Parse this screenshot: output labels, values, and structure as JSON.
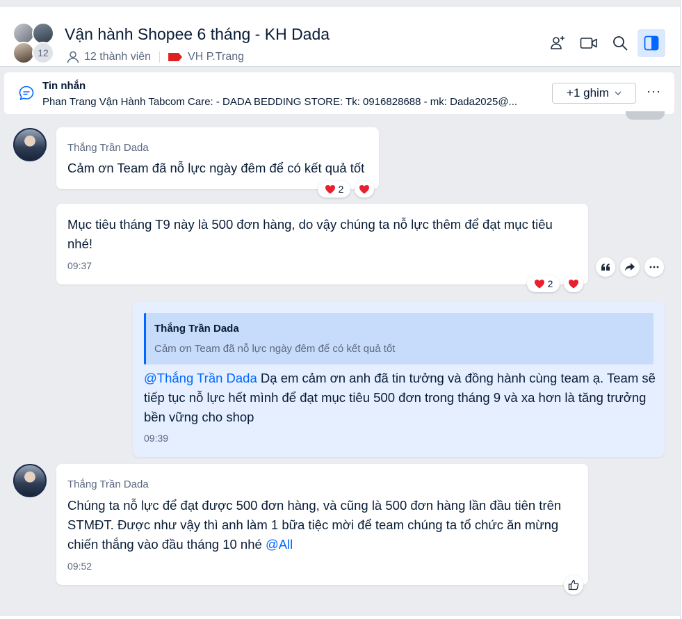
{
  "header": {
    "group_title": "Vận hành Shopee 6 tháng - KH Dada",
    "member_count_badge": "12",
    "members_label": "12 thành viên",
    "label_tag": "VH P.Trang",
    "icons": [
      "add-member-icon",
      "video-call-icon",
      "search-icon",
      "sidebar-toggle-icon"
    ]
  },
  "pinned": {
    "title": "Tin nhắn",
    "text": "Phan Trang Vận Hành Tabcom Care: - DADA BEDDING STORE: Tk: 0916828688 - mk: Dada2025@...",
    "button_label": "+1 ghim",
    "more_label": "···"
  },
  "messages": [
    {
      "sender": "Thắng Trần Dada",
      "text": "Cảm ơn Team đã nỗ lực ngày đêm để có kết quả tốt",
      "reaction_count": "2"
    },
    {
      "text": "Mục tiêu tháng T9 này là 500 đơn hàng, do vậy chúng ta nỗ lực thêm để đạt mục tiêu nhé!",
      "time": "09:37",
      "reaction_count": "2"
    },
    {
      "quote_sender": "Thắng Trần Dada",
      "quote_text": "Cảm ơn Team đã nỗ lực ngày đêm để có kết quả tốt",
      "mention": "@Thắng Trần Dada",
      "text": " Dạ em cảm ơn anh đã tin tưởng và đồng hành cùng team ạ. Team sẽ tiếp tục nỗ lực hết mình để đạt mục tiêu 500 đơn trong tháng 9 và xa hơn là tăng trưởng bền vững cho shop",
      "time": "09:39"
    },
    {
      "sender": "Thắng Trần Dada",
      "text": "Chúng ta nỗ lực để đạt được 500 đơn hàng, và cũng là 500 đơn hàng lần đầu tiên trên STMĐT. Được như vậy thì anh làm 1 bữa tiệc mời để team chúng ta tổ chức ăn mừng chiến thắng vào đầu tháng 10 nhé ",
      "mention": "@All",
      "time": "09:52"
    }
  ],
  "colors": {
    "accent": "#0068ff",
    "own_bubble": "#e5efff",
    "quote_bg": "#c7dcfa",
    "heart": "#e8212e",
    "tag": "#e02020"
  }
}
